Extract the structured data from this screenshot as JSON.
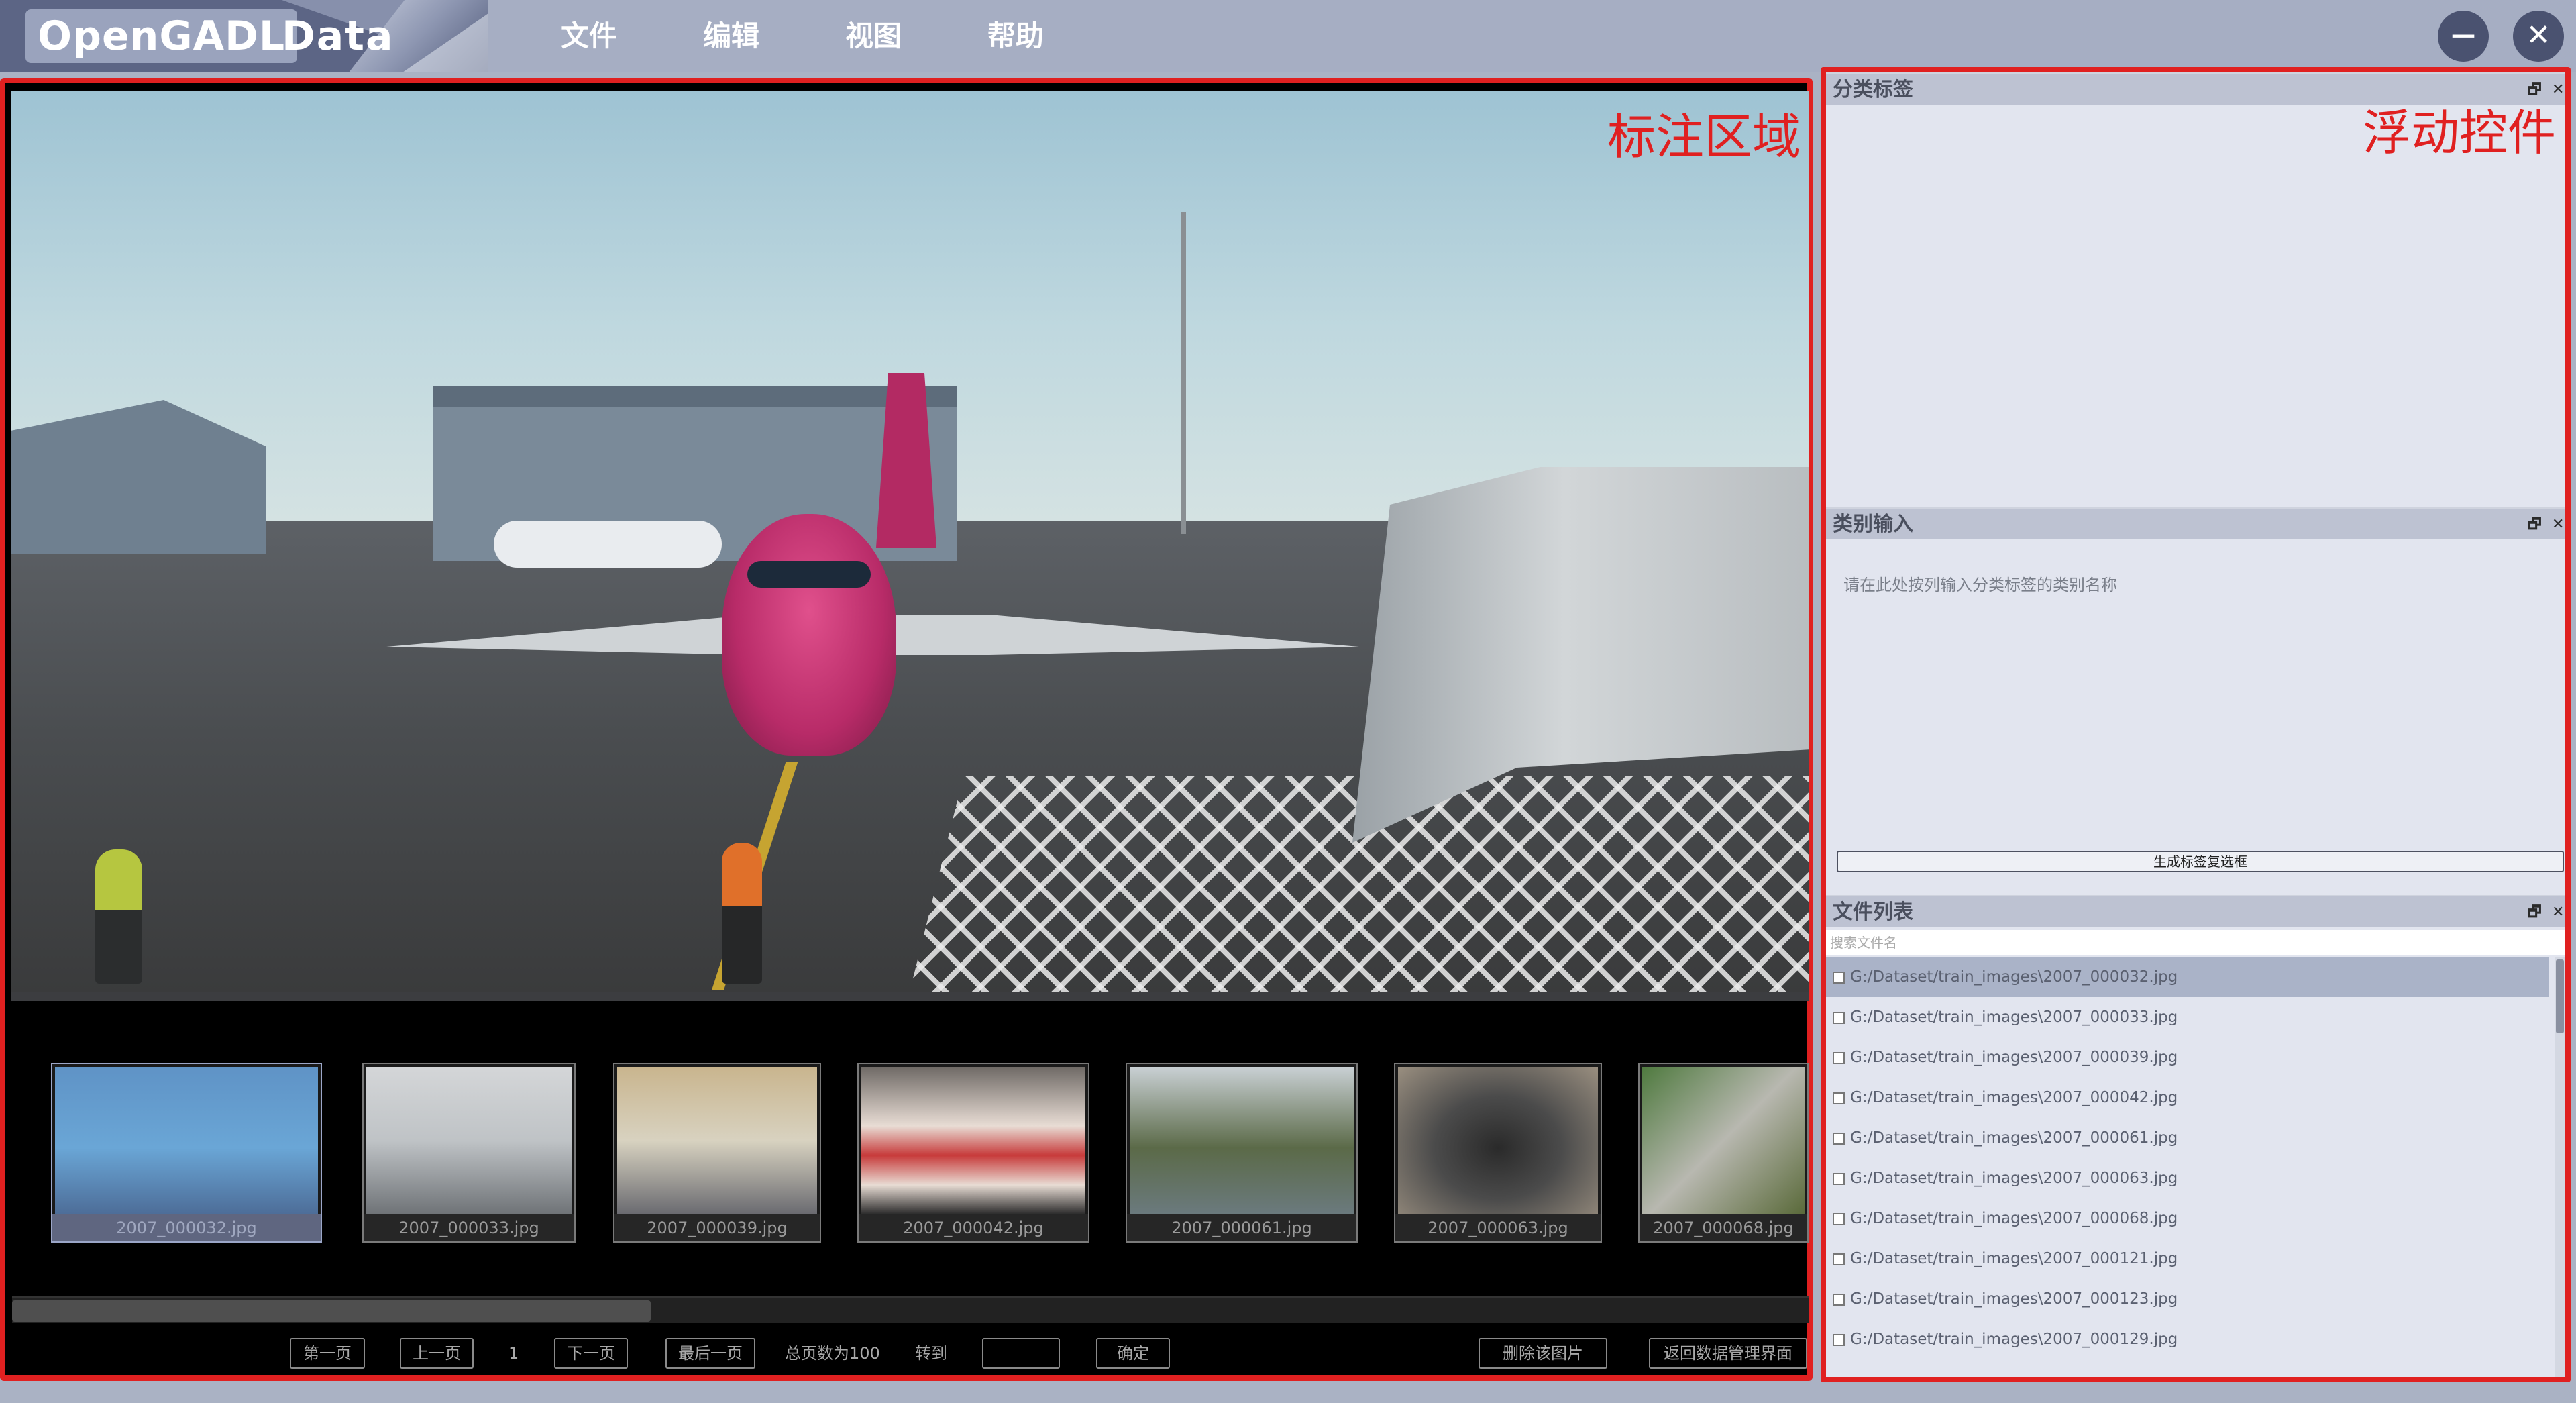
{
  "app": {
    "logo_primary": "OpenGADL",
    "logo_secondary": "Data"
  },
  "menu": [
    {
      "label": "文件"
    },
    {
      "label": "编辑"
    },
    {
      "label": "视图"
    },
    {
      "label": "帮助"
    }
  ],
  "window": {
    "minimize": "−",
    "close": "✕"
  },
  "annotation_area": {
    "label": "标注区域"
  },
  "thumbnails": [
    {
      "caption": "2007_000032.jpg",
      "selected": true
    },
    {
      "caption": "2007_000033.jpg"
    },
    {
      "caption": "2007_000039.jpg"
    },
    {
      "caption": "2007_000042.jpg"
    },
    {
      "caption": "2007_000061.jpg"
    },
    {
      "caption": "2007_000063.jpg"
    },
    {
      "caption": "2007_000068.jpg"
    }
  ],
  "pager": {
    "first": "第一页",
    "prev": "上一页",
    "current": "1",
    "next": "下一页",
    "last": "最后一页",
    "total": "总页数为100",
    "goto": "转到",
    "confirm": "确定",
    "delete": "删除该图片",
    "back": "返回数据管理界面"
  },
  "dock": {
    "label": "浮动控件",
    "float_icon": "🗗",
    "close_icon": "✕",
    "classify_panel": {
      "title": "分类标签"
    },
    "category_panel": {
      "title": "类别输入",
      "hint": "请在此处按列输入分类标签的类别名称",
      "generate_button": "生成标签复选框"
    },
    "file_panel": {
      "title": "文件列表",
      "search_placeholder": "搜索文件名",
      "files": [
        "G:/Dataset/train_images\\2007_000032.jpg",
        "G:/Dataset/train_images\\2007_000033.jpg",
        "G:/Dataset/train_images\\2007_000039.jpg",
        "G:/Dataset/train_images\\2007_000042.jpg",
        "G:/Dataset/train_images\\2007_000061.jpg",
        "G:/Dataset/train_images\\2007_000063.jpg",
        "G:/Dataset/train_images\\2007_000068.jpg",
        "G:/Dataset/train_images\\2007_000121.jpg",
        "G:/Dataset/train_images\\2007_000123.jpg",
        "G:/Dataset/train_images\\2007_000129.jpg"
      ]
    }
  }
}
